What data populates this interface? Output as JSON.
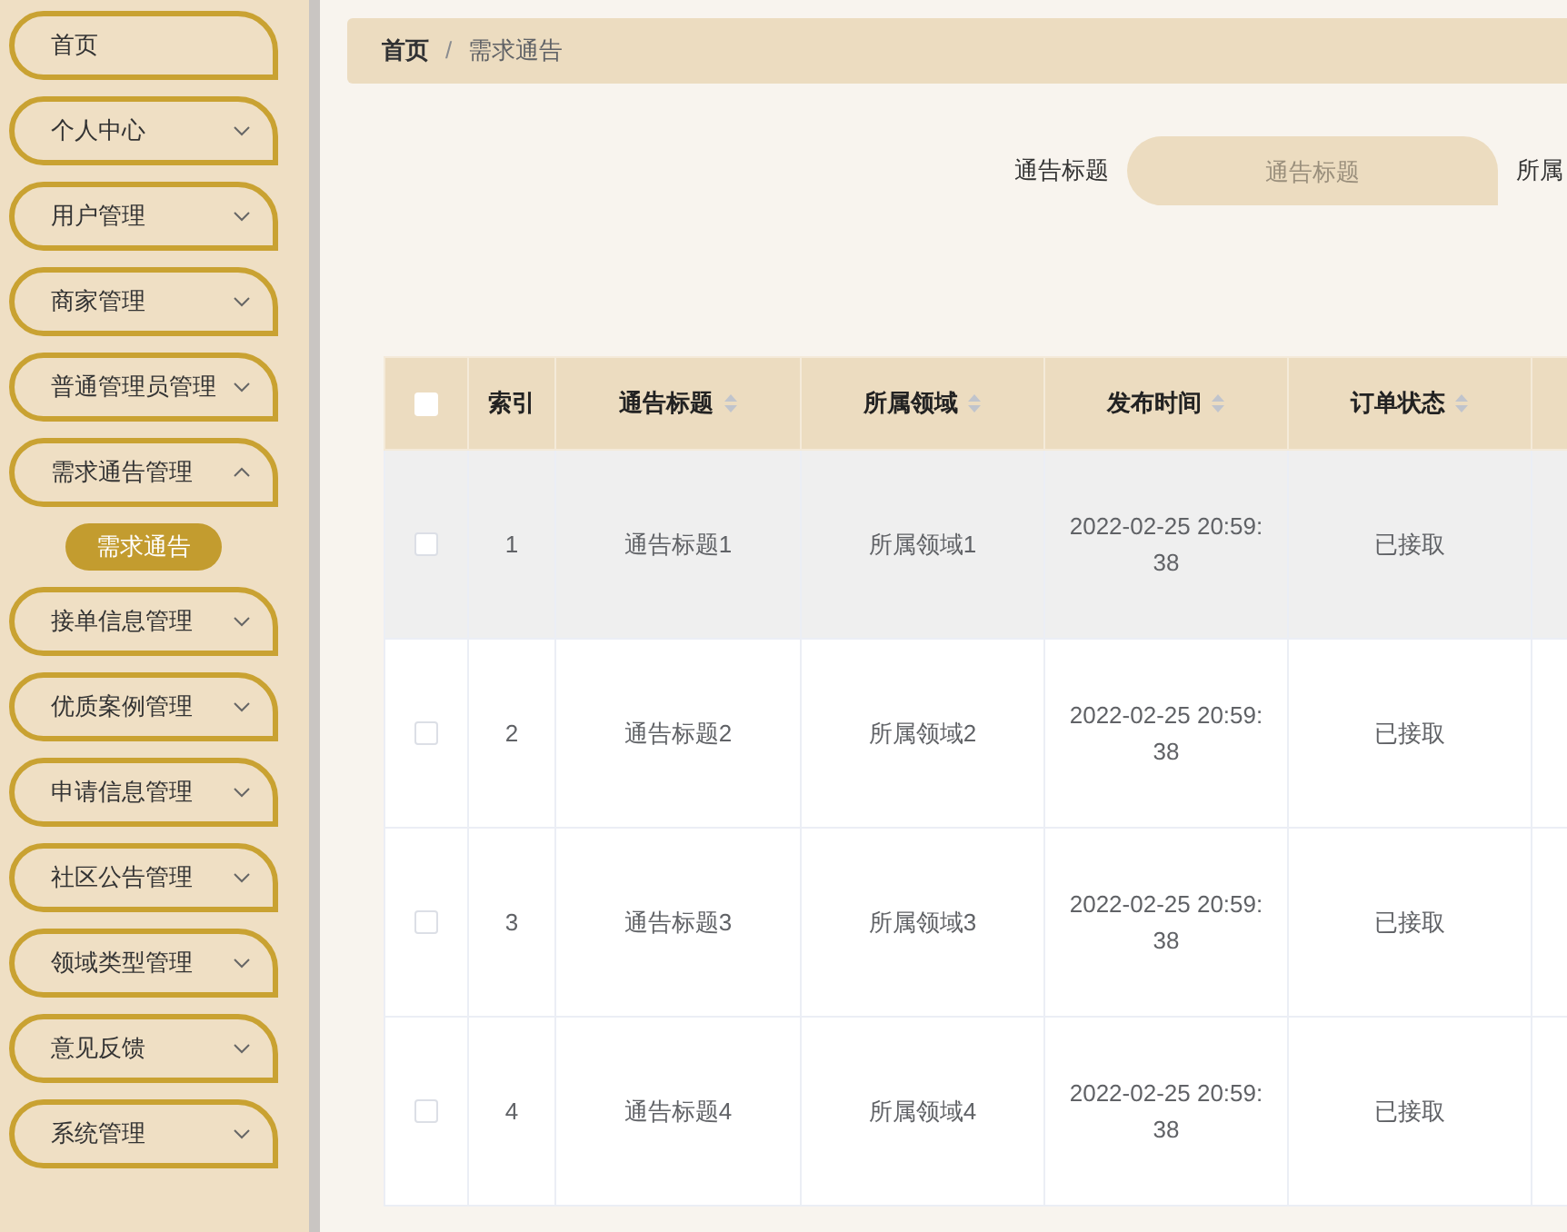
{
  "sidebar": {
    "items": [
      {
        "label": "首页",
        "kind": "link"
      },
      {
        "label": "个人中心",
        "kind": "menu",
        "expanded": false
      },
      {
        "label": "用户管理",
        "kind": "menu",
        "expanded": false
      },
      {
        "label": "商家管理",
        "kind": "menu",
        "expanded": false
      },
      {
        "label": "普通管理员管理",
        "kind": "menu",
        "expanded": false
      },
      {
        "label": "需求通告管理",
        "kind": "menu",
        "expanded": true,
        "children": [
          {
            "label": "需求通告",
            "selected": true
          }
        ]
      },
      {
        "label": "接单信息管理",
        "kind": "menu",
        "expanded": false
      },
      {
        "label": "优质案例管理",
        "kind": "menu",
        "expanded": false
      },
      {
        "label": "申请信息管理",
        "kind": "menu",
        "expanded": false
      },
      {
        "label": "社区公告管理",
        "kind": "menu",
        "expanded": false
      },
      {
        "label": "领域类型管理",
        "kind": "menu",
        "expanded": false
      },
      {
        "label": "意见反馈",
        "kind": "menu",
        "expanded": false
      },
      {
        "label": "系统管理",
        "kind": "menu",
        "expanded": false
      }
    ]
  },
  "breadcrumb": {
    "separator": "/",
    "items": [
      "首页",
      "需求通告"
    ]
  },
  "search": {
    "label": "通告标题",
    "placeholder": "通告标题",
    "label_2": "所属"
  },
  "table": {
    "header_checkbox": {
      "checked": false
    },
    "columns": [
      {
        "label": "索引",
        "sortable": false
      },
      {
        "label": "通告标题",
        "sortable": true
      },
      {
        "label": "所属领域",
        "sortable": true
      },
      {
        "label": "发布时间",
        "sortable": true
      },
      {
        "label": "订单状态",
        "sortable": true
      }
    ],
    "rows": [
      {
        "checked": false,
        "highlighted": true,
        "cells": [
          "1",
          "通告标题1",
          "所属领域1",
          "2022-02-25 20:59:38",
          "已接取"
        ]
      },
      {
        "checked": false,
        "highlighted": false,
        "cells": [
          "2",
          "通告标题2",
          "所属领域2",
          "2022-02-25 20:59:38",
          "已接取"
        ]
      },
      {
        "checked": false,
        "highlighted": false,
        "cells": [
          "3",
          "通告标题3",
          "所属领域3",
          "2022-02-25 20:59:38",
          "已接取"
        ]
      },
      {
        "checked": false,
        "highlighted": false,
        "cells": [
          "4",
          "通告标题4",
          "所属领域4",
          "2022-02-25 20:59:38",
          "已接取"
        ]
      }
    ]
  }
}
